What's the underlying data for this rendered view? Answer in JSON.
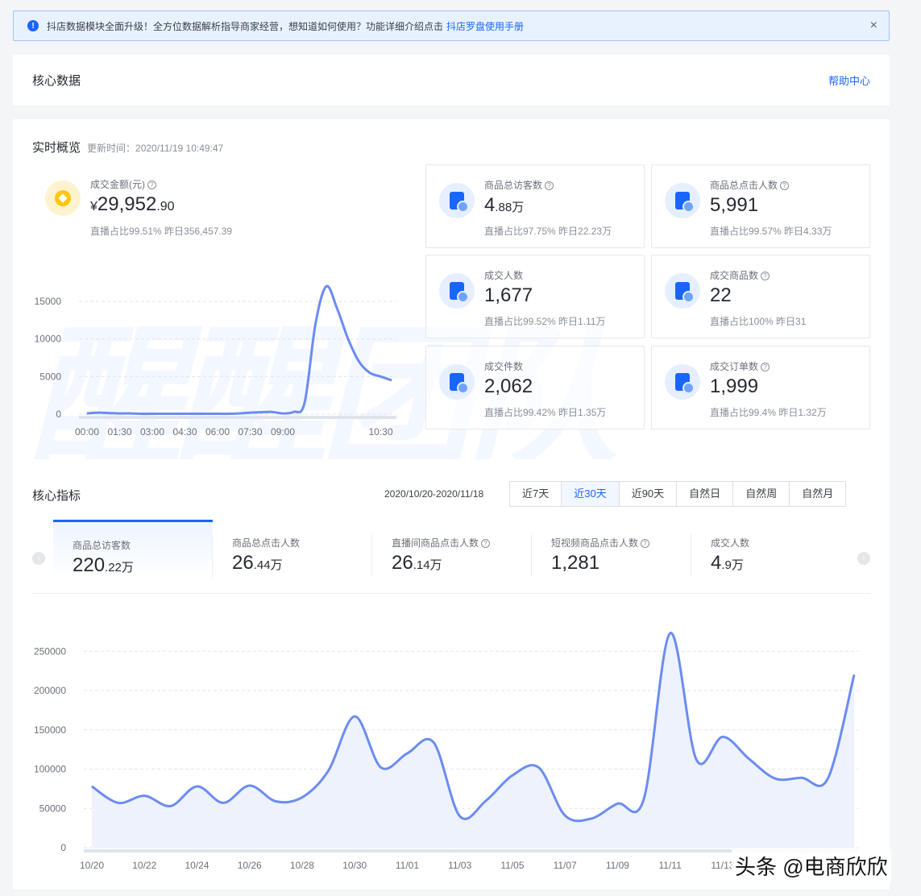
{
  "notice": {
    "text": "抖店数据模块全面升级！全方位数据解析指导商家经营，想知道如何使用？功能详细介绍点击",
    "link": "抖店罗盘使用手册",
    "close": "×"
  },
  "header": {
    "title": "核心数据",
    "help": "帮助中心"
  },
  "realtime": {
    "title": "实时概览",
    "update_time": "更新时间：2020/11/19 10:49:47",
    "gmv": {
      "label": "成交金额(元)",
      "currency": "¥",
      "int": "29,952",
      "dec": ".90",
      "sub": "直播占比99.51%  昨日356,457.39"
    },
    "boxes": [
      {
        "label": "商品总访客数",
        "int": "4",
        "dec": ".88万",
        "sub": "直播占比97.75%  昨日22.23万",
        "icon": "shopping-bag-icon"
      },
      {
        "label": "商品总点击人数",
        "int": "5,991",
        "dec": "",
        "sub": "直播占比99.57%  昨日4.33万",
        "icon": "click-bag-icon"
      },
      {
        "label": "成交人数",
        "int": "1,677",
        "dec": "",
        "sub": "直播占比99.52%  昨日1.11万",
        "icon": "buyer-icon"
      },
      {
        "label": "成交商品数",
        "int": "22",
        "dec": "",
        "sub": "直播占比100%  昨日31",
        "icon": "product-icon"
      },
      {
        "label": "成交件数",
        "int": "2,062",
        "dec": "",
        "sub": "直播占比99.42%  昨日1.35万",
        "icon": "cart-bag-icon"
      },
      {
        "label": "成交订单数",
        "int": "1,999",
        "dec": "",
        "sub": "直播占比99.4%  昨日1.32万",
        "icon": "order-icon"
      }
    ]
  },
  "core": {
    "title": "核心指标",
    "date_range": "2020/10/20-2020/11/18",
    "ranges": [
      "近7天",
      "近30天",
      "近90天",
      "自然日",
      "自然周",
      "自然月"
    ],
    "active_range": 1,
    "tabs": [
      {
        "label": "商品总访客数",
        "int": "220",
        "dec": ".22万",
        "q": false
      },
      {
        "label": "商品总点击人数",
        "int": "26",
        "dec": ".44万",
        "q": false
      },
      {
        "label": "直播间商品点击人数",
        "int": "26",
        "dec": ".14万",
        "q": true
      },
      {
        "label": "短视频商品点击人数",
        "int": "1,281",
        "dec": "",
        "q": true
      },
      {
        "label": "成交人数",
        "int": "4",
        "dec": ".9万",
        "q": false
      }
    ]
  },
  "watermark": "醒醒团队",
  "footer_mark": "头条 @电商欣欣",
  "colors": {
    "accent": "#1966ff",
    "line": "#6b8cf0",
    "fill": "#eef2fd"
  },
  "chart_data": [
    {
      "type": "line",
      "x": [
        "00:00",
        "00:30",
        "01:00",
        "01:30",
        "02:00",
        "02:30",
        "03:00",
        "03:30",
        "04:00",
        "04:30",
        "05:00",
        "05:30",
        "06:00",
        "06:30",
        "07:00",
        "07:30",
        "08:00",
        "08:30",
        "09:00",
        "09:10",
        "09:20",
        "09:30",
        "09:40",
        "09:50",
        "10:00",
        "10:10",
        "10:20",
        "10:30",
        "10:40"
      ],
      "xticks": [
        "00:00",
        "01:30",
        "03:00",
        "04:30",
        "06:00",
        "07:30",
        "09:00",
        "10:30"
      ],
      "values": [
        100,
        200,
        150,
        100,
        100,
        50,
        50,
        50,
        50,
        50,
        50,
        50,
        50,
        50,
        100,
        200,
        250,
        300,
        100,
        300,
        1500,
        12000,
        17000,
        14000,
        10000,
        7000,
        5500,
        5000,
        4500
      ],
      "yticks": [
        0,
        5000,
        10000,
        15000
      ],
      "ylim": [
        0,
        18000
      ]
    },
    {
      "type": "area",
      "x": [
        "10/20",
        "10/21",
        "10/22",
        "10/23",
        "10/24",
        "10/25",
        "10/26",
        "10/27",
        "10/28",
        "10/29",
        "10/30",
        "10/31",
        "11/01",
        "11/02",
        "11/03",
        "11/04",
        "11/05",
        "11/06",
        "11/07",
        "11/08",
        "11/09",
        "11/10",
        "11/11",
        "11/12",
        "11/13",
        "11/14",
        "11/15",
        "11/16",
        "11/17",
        "11/18"
      ],
      "xticks": [
        "10/20",
        "10/22",
        "10/24",
        "10/26",
        "10/28",
        "10/30",
        "11/01",
        "11/03",
        "11/05",
        "11/07",
        "11/09",
        "11/11",
        "11/13"
      ],
      "values": [
        78000,
        57000,
        66000,
        53000,
        78000,
        57000,
        79000,
        59000,
        64000,
        98000,
        167000,
        102000,
        120000,
        134000,
        40000,
        60000,
        92000,
        102000,
        41000,
        37000,
        56000,
        62000,
        273000,
        112000,
        141000,
        113000,
        88000,
        89000,
        88000,
        220000
      ],
      "yticks": [
        0,
        50000,
        100000,
        150000,
        200000,
        250000
      ],
      "ylim": [
        0,
        280000
      ]
    }
  ]
}
